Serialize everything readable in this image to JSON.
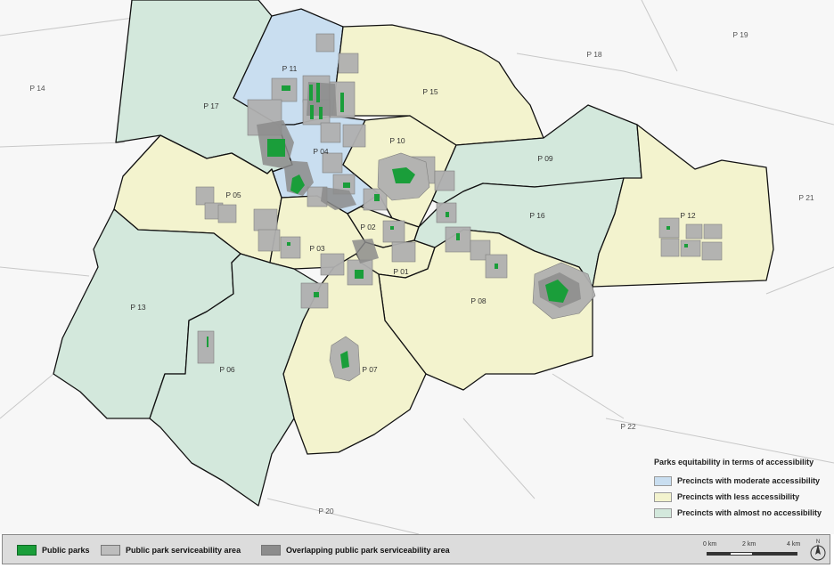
{
  "colors": {
    "moderate": "#c9def0",
    "less": "#f3f3ce",
    "none": "#d3e8dc",
    "park": "#1a9e3a",
    "service_area": "#b8b8b8",
    "overlap": "#909090",
    "outside": "#f7f7f7",
    "boundary": "#111111"
  },
  "precincts": [
    {
      "id": "P 01",
      "class": "less"
    },
    {
      "id": "P 02",
      "class": "less"
    },
    {
      "id": "P 03",
      "class": "less"
    },
    {
      "id": "P 04",
      "class": "moderate"
    },
    {
      "id": "P 05",
      "class": "less"
    },
    {
      "id": "P 06",
      "class": "none"
    },
    {
      "id": "P 07",
      "class": "less"
    },
    {
      "id": "P 08",
      "class": "less"
    },
    {
      "id": "P 09",
      "class": "none"
    },
    {
      "id": "P 10",
      "class": "less"
    },
    {
      "id": "P 11",
      "class": "moderate"
    },
    {
      "id": "P 12",
      "class": "less"
    },
    {
      "id": "P 13",
      "class": "none"
    },
    {
      "id": "P 15",
      "class": "less"
    },
    {
      "id": "P 16",
      "class": "none"
    },
    {
      "id": "P 17",
      "class": "none"
    }
  ],
  "outside_labels": [
    "P 14",
    "P 18",
    "P 19",
    "P 20",
    "P 21",
    "P 22"
  ],
  "legend": {
    "title": "Parks equitability in terms of accessibility",
    "moderate": "Precincts with moderate accessibility",
    "less": "Precincts with less accessibility",
    "none": "Precincts with almost no accessibility"
  },
  "bottom_legend": {
    "parks": "Public parks",
    "serviceability": "Public park serviceability area",
    "overlap": "Overlapping public park serviceability area"
  },
  "scale": {
    "labels": [
      "0 km",
      "2 km",
      "4 km"
    ]
  },
  "north_label": "N"
}
